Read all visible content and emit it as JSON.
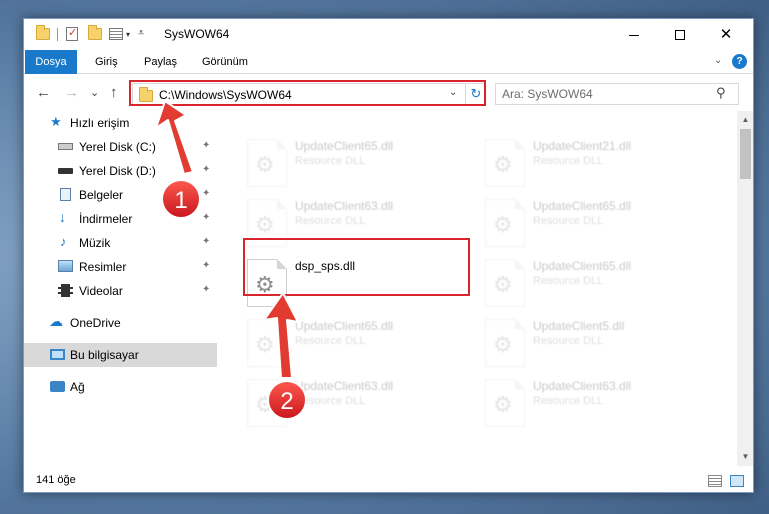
{
  "window": {
    "title": "SysWOW64"
  },
  "quick_access_toolbar": {
    "separator": "|",
    "dropdown": "▾"
  },
  "ribbon": {
    "tabs": [
      {
        "label": "Dosya"
      },
      {
        "label": "Giriş"
      },
      {
        "label": "Paylaş"
      },
      {
        "label": "Görünüm"
      }
    ],
    "expand_glyph": "⌄",
    "help_glyph": "?"
  },
  "navigation": {
    "back_glyph": "←",
    "forward_glyph": "→",
    "recent_glyph": "⌄",
    "up_glyph": "↑"
  },
  "address_bar": {
    "path": "C:\\Windows\\SysWOW64",
    "dropdown_glyph": "⌄",
    "refresh_glyph": "↻"
  },
  "search": {
    "placeholder": "Ara: SysWOW64",
    "icon_glyph": "⚲"
  },
  "sidebar": {
    "items": [
      {
        "label": "Hızlı erişim",
        "icon": "star-icon"
      },
      {
        "label": "Yerel Disk (C:)",
        "icon": "drive-icon",
        "pinned": true
      },
      {
        "label": "Yerel Disk (D:)",
        "icon": "drive-icon",
        "pinned": true
      },
      {
        "label": "Belgeler",
        "icon": "documents-icon",
        "pinned": true
      },
      {
        "label": "İndirmeler",
        "icon": "downloads-icon",
        "pinned": true
      },
      {
        "label": "Müzik",
        "icon": "music-icon",
        "pinned": true
      },
      {
        "label": "Resimler",
        "icon": "pictures-icon",
        "pinned": true
      },
      {
        "label": "Videolar",
        "icon": "videos-icon",
        "pinned": true
      },
      {
        "label": "OneDrive",
        "icon": "onedrive-icon"
      },
      {
        "label": "Bu bilgisayar",
        "icon": "computer-icon",
        "selected": true
      },
      {
        "label": "Ağ",
        "icon": "network-icon"
      }
    ],
    "pin_glyph": "📌"
  },
  "files": [
    {
      "name": "UpdateClient65.dll",
      "type": "Resource DLL",
      "faded": true
    },
    {
      "name": "UpdateClient21.dll",
      "type": "Resource DLL",
      "faded": true
    },
    {
      "name": "UpdateClient63.dll",
      "type": "Resource DLL",
      "faded": true
    },
    {
      "name": "UpdateClient65.dll",
      "type": "Resource DLL",
      "faded": true
    },
    {
      "name": "dsp_sps.dll",
      "type": "",
      "faded": false
    },
    {
      "name": "UpdateClient65.dll",
      "type": "Resource DLL",
      "faded": true
    },
    {
      "name": "UpdateClient65.dll",
      "type": "Resource DLL",
      "faded": true
    },
    {
      "name": "UpdateClient5.dll",
      "type": "Resource DLL",
      "faded": true
    },
    {
      "name": "UpdateClient63.dll",
      "type": "Resource DLL",
      "faded": true
    },
    {
      "name": "UpdateClient63.dll",
      "type": "Resource DLL",
      "faded": true
    }
  ],
  "status_bar": {
    "item_count": "141 öğe"
  },
  "annotations": {
    "step1": "1",
    "step2": "2",
    "highlight_color": "#d9262c"
  },
  "colors": {
    "accent": "#1979ca",
    "selection": "#d9d9d9"
  }
}
